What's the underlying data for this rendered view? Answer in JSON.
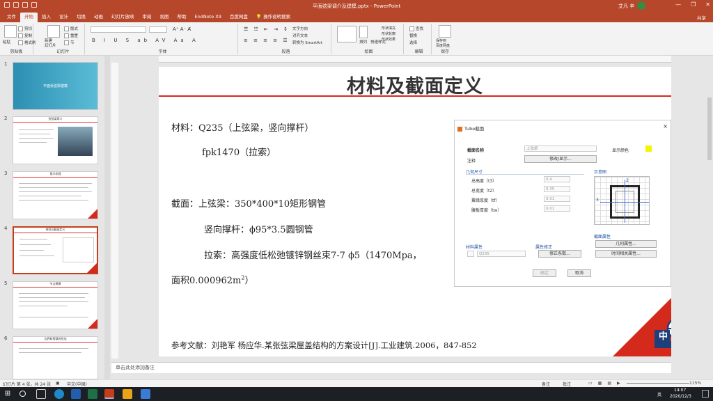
{
  "window": {
    "title": "平面弦梁调介及建模.pptx - PowerPoint",
    "user": "艾凡 辛",
    "controls": [
      "—",
      "❐",
      "✕"
    ]
  },
  "tabs": [
    "文件",
    "开始",
    "插入",
    "设计",
    "切换",
    "动画",
    "幻灯片放映",
    "审阅",
    "视图",
    "帮助",
    "EndNote X9",
    "百度网盘"
  ],
  "active_tab": "开始",
  "tell_me": "操作说明搜索",
  "share": "共享",
  "ribbon": {
    "groups": [
      "剪贴板",
      "幻灯片",
      "字体",
      "段落",
      "绘图",
      "编辑",
      "保存"
    ],
    "paste": "粘贴",
    "cut": "剪切",
    "copy": "复制",
    "format_painter": "格式刷",
    "new_slide": "新建\n幻灯片",
    "layout": "版式",
    "reset": "重置",
    "section": "节",
    "text_direction": "文字方向",
    "align_text": "对齐文本",
    "smartart": "转换为 SmartArt",
    "arrange": "排列",
    "quick_styles": "快速样式",
    "shape_fill": "形状填充",
    "shape_outline": "形状轮廓",
    "shape_effects": "形状效果",
    "find": "查找",
    "replace": "替换",
    "select": "选择",
    "save_to_baidu": "保存到\n百度网盘"
  },
  "thumbnails": [
    {
      "num": "1",
      "title": "平面张弦梁建模"
    },
    {
      "num": "2",
      "title": "张弦梁简介"
    },
    {
      "num": "3",
      "title": "报示机理"
    },
    {
      "num": "4",
      "title": "材料及截面定义"
    },
    {
      "num": "5",
      "title": "节点建模"
    },
    {
      "num": "6",
      "title": "边界和荷载的附加"
    }
  ],
  "slide": {
    "title": "材料及截面定义",
    "line1": "材料：Q235（上弦梁，竖向撑杆）",
    "line2": "fpk1470（拉索）",
    "line3": "截面：上弦梁：350*400*10矩形钢管",
    "line4": "竖向撑杆：ϕ95*3.5圆钢管",
    "line5": "拉索：高强度低松弛镀锌钢丝束7-7 ϕ5（1470Mpa，",
    "line6": "面积0.000962m",
    "line6_sup": "2",
    "line6_end": "）",
    "reference": "参考文献：刘艳军 杨应华.某张弦梁屋盖结构的方案设计[J].工业建筑.2006，847-852",
    "logo_text": "中"
  },
  "dialog": {
    "title": "Tube截面",
    "close": "×",
    "name_label": "截面名称",
    "name_value": "上弦梁",
    "color_label": "显示颜色",
    "note_label": "注释",
    "modify_btn": "修改/显示...",
    "dims_label": "几何尺寸",
    "diagram_label": "示意图",
    "fields": [
      {
        "label": "总高度（t3）",
        "value": "0.4"
      },
      {
        "label": "总宽度（t2）",
        "value": "0.35"
      },
      {
        "label": "翼缘厚度（tf）",
        "value": "0.01"
      },
      {
        "label": "腹板厚度（tw）",
        "value": "0.01"
      }
    ],
    "diag_axis_top": "2",
    "diag_axis_left": "3",
    "material_label": "材料属性",
    "material_value": "Q235",
    "modifier_label": "属性修正",
    "modifier_btn": "修正系数...",
    "section_props_label": "截面属性",
    "geom_btn": "几何属性...",
    "time_btn": "时间相关属性...",
    "ok": "确定",
    "cancel": "取消"
  },
  "notes_placeholder": "单击此处添加备注",
  "status": {
    "slide_info": "幻灯片 第 4 张，共 24 张",
    "language": "中文(中国)",
    "notes": "备注",
    "comments": "批注",
    "zoom": "115%"
  },
  "taskbar": {
    "time": "14:07",
    "date": "2020/12/3",
    "ime": "英"
  }
}
